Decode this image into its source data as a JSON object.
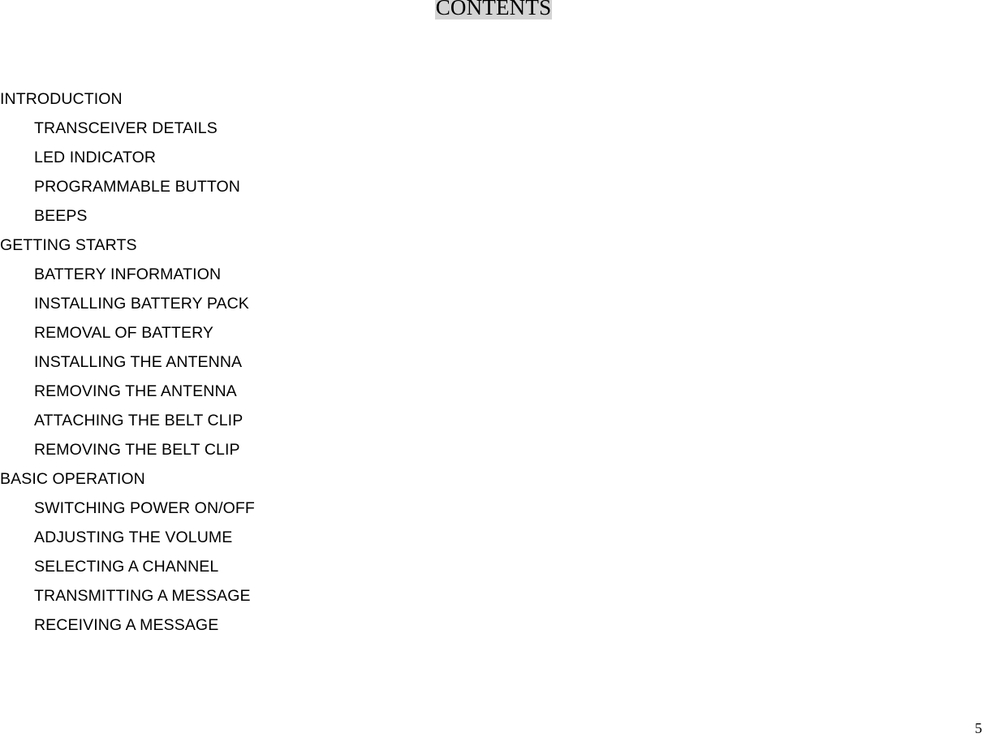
{
  "document": {
    "title": "CONTENTS",
    "title_highlight_color": "#d4d4d4",
    "text_color": "#000000",
    "background_color": "#ffffff",
    "page_number": "5"
  },
  "toc": {
    "entries": [
      {
        "label": "INTRODUCTION",
        "level": 0
      },
      {
        "label": "TRANSCEIVER DETAILS",
        "level": 1
      },
      {
        "label": "LED INDICATOR",
        "level": 1
      },
      {
        "label": "PROGRAMMABLE BUTTON",
        "level": 1
      },
      {
        "label": "BEEPS",
        "level": 1
      },
      {
        "label": "GETTING STARTS",
        "level": 0
      },
      {
        "label": "BATTERY INFORMATION",
        "level": 1
      },
      {
        "label": "INSTALLING BATTERY PACK",
        "level": 1
      },
      {
        "label": "REMOVAL OF BATTERY",
        "level": 1
      },
      {
        "label": "INSTALLING THE ANTENNA",
        "level": 1
      },
      {
        "label": "REMOVING THE ANTENNA",
        "level": 1
      },
      {
        "label": "ATTACHING THE BELT CLIP",
        "level": 1
      },
      {
        "label": "REMOVING THE BELT CLIP",
        "level": 1
      },
      {
        "label": "BASIC OPERATION",
        "level": 0
      },
      {
        "label": "SWITCHING POWER ON/OFF",
        "level": 1
      },
      {
        "label": "ADJUSTING THE VOLUME",
        "level": 1
      },
      {
        "label": "SELECTING A CHANNEL",
        "level": 1
      },
      {
        "label": "TRANSMITTING A MESSAGE",
        "level": 1
      },
      {
        "label": "RECEIVING A MESSAGE",
        "level": 1
      }
    ]
  }
}
